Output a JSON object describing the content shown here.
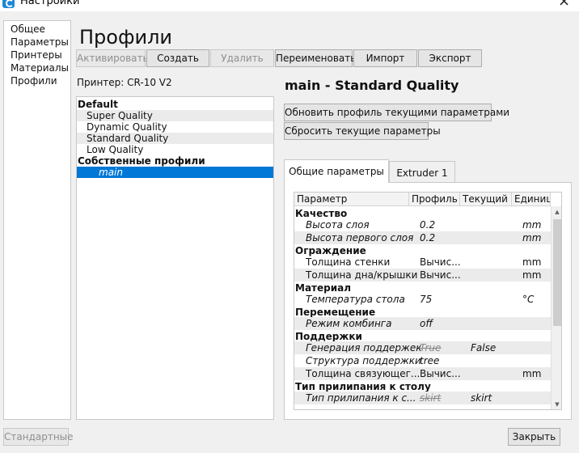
{
  "window": {
    "title": "Настройки",
    "close_glyph": "×"
  },
  "sidebar": {
    "items": [
      {
        "label": "Общее"
      },
      {
        "label": "Параметры"
      },
      {
        "label": "Принтеры"
      },
      {
        "label": "Материалы"
      },
      {
        "label": "Профили"
      }
    ]
  },
  "page": {
    "title": "Профили"
  },
  "toolbar": {
    "activate_label": "Активировать",
    "create_label": "Создать",
    "delete_label": "Удалить",
    "rename_label": "Переименовать",
    "import_label": "Импорт",
    "export_label": "Экспорт"
  },
  "printer": {
    "label": "Принтер: CR-10 V2"
  },
  "profiles": {
    "default_header": "Default",
    "default_items": [
      "Super Quality",
      "Dynamic Quality",
      "Standard Quality",
      "Low Quality"
    ],
    "custom_header": "Собственные профили",
    "custom_items": [
      "main"
    ]
  },
  "detail": {
    "heading": "main - Standard Quality",
    "update_button": "Обновить профиль текущими параметрами",
    "reset_button": "Сбросить текущие параметры",
    "tabs": [
      {
        "label": "Общие параметры",
        "active": true
      },
      {
        "label": "Extruder 1",
        "active": false
      }
    ]
  },
  "settings_table": {
    "columns": [
      "Параметр",
      "Профиль",
      "Текущий",
      "Единица"
    ],
    "rows": [
      {
        "kind": "category",
        "name": "Качество"
      },
      {
        "kind": "setting",
        "name": "Высота слоя",
        "profile": "0.2",
        "current": "",
        "unit": "mm",
        "italic": true
      },
      {
        "kind": "setting",
        "name": "Высота первого слоя",
        "profile": "0.2",
        "current": "",
        "unit": "mm",
        "italic": true
      },
      {
        "kind": "category",
        "name": "Ограждение"
      },
      {
        "kind": "setting",
        "name": "Толщина стенки",
        "profile": "Вычис...",
        "current": "",
        "unit": "mm",
        "italic": false
      },
      {
        "kind": "setting",
        "name": "Толщина дна/крышки",
        "profile": "Вычис...",
        "current": "",
        "unit": "mm",
        "italic": false
      },
      {
        "kind": "category",
        "name": "Материал"
      },
      {
        "kind": "setting",
        "name": "Температура стола",
        "profile": "75",
        "current": "",
        "unit": "°C",
        "italic": true
      },
      {
        "kind": "category",
        "name": "Перемещение"
      },
      {
        "kind": "setting",
        "name": "Режим комбинга",
        "profile": "off",
        "current": "",
        "unit": "",
        "italic": true
      },
      {
        "kind": "category",
        "name": "Поддержки"
      },
      {
        "kind": "setting",
        "name": "Генерация поддержек",
        "profile": "True",
        "current": "False",
        "unit": "",
        "italic": true,
        "profile_struck": true
      },
      {
        "kind": "setting",
        "name": "Структура поддержки",
        "profile": "tree",
        "current": "",
        "unit": "",
        "italic": true
      },
      {
        "kind": "setting",
        "name": "Толщина связующег...",
        "profile": "Вычис...",
        "current": "",
        "unit": "mm",
        "italic": false
      },
      {
        "kind": "category",
        "name": "Тип прилипания к столу"
      },
      {
        "kind": "setting",
        "name": "Тип прилипания к с...",
        "profile": "skirt",
        "current": "skirt",
        "unit": "",
        "italic": true,
        "profile_struck": true
      }
    ]
  },
  "scrollbar": {
    "up_glyph": "▲",
    "down_glyph": "▼"
  },
  "footer": {
    "defaults_label": "Стандартные",
    "close_label": "Закрыть"
  }
}
